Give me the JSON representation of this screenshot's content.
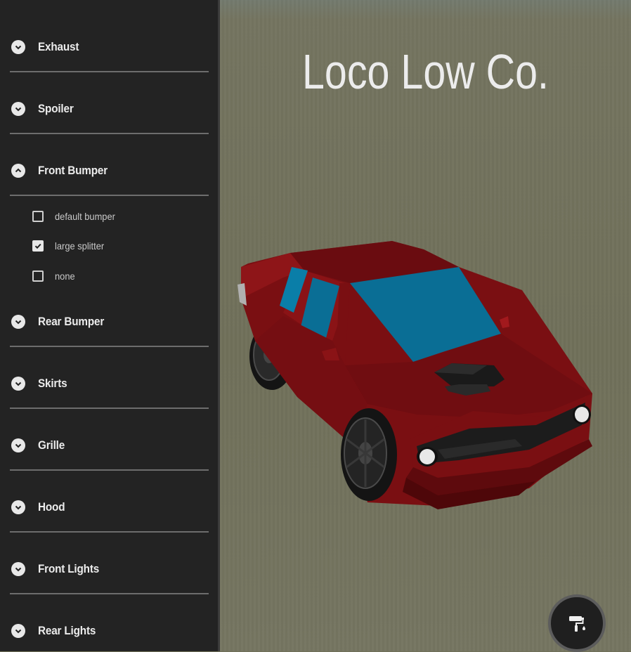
{
  "sidebar": {
    "sections": [
      {
        "label": "Exhaust",
        "expanded": false
      },
      {
        "label": "Spoiler",
        "expanded": false
      },
      {
        "label": "Front Bumper",
        "expanded": true,
        "options": [
          {
            "label": "default bumper",
            "checked": false
          },
          {
            "label": "large splitter",
            "checked": true
          },
          {
            "label": "none",
            "checked": false
          }
        ]
      },
      {
        "label": "Rear Bumper",
        "expanded": false
      },
      {
        "label": "Skirts",
        "expanded": false
      },
      {
        "label": "Grille",
        "expanded": false
      },
      {
        "label": "Hood",
        "expanded": false
      },
      {
        "label": "Front Lights",
        "expanded": false
      },
      {
        "label": "Rear Lights",
        "expanded": false
      }
    ]
  },
  "viewport": {
    "brand": "Loco Low Co.",
    "car_color": "#7a0f12",
    "glass_color": "#0a6e95"
  },
  "paint_button": {
    "icon": "paint-roller-icon"
  }
}
